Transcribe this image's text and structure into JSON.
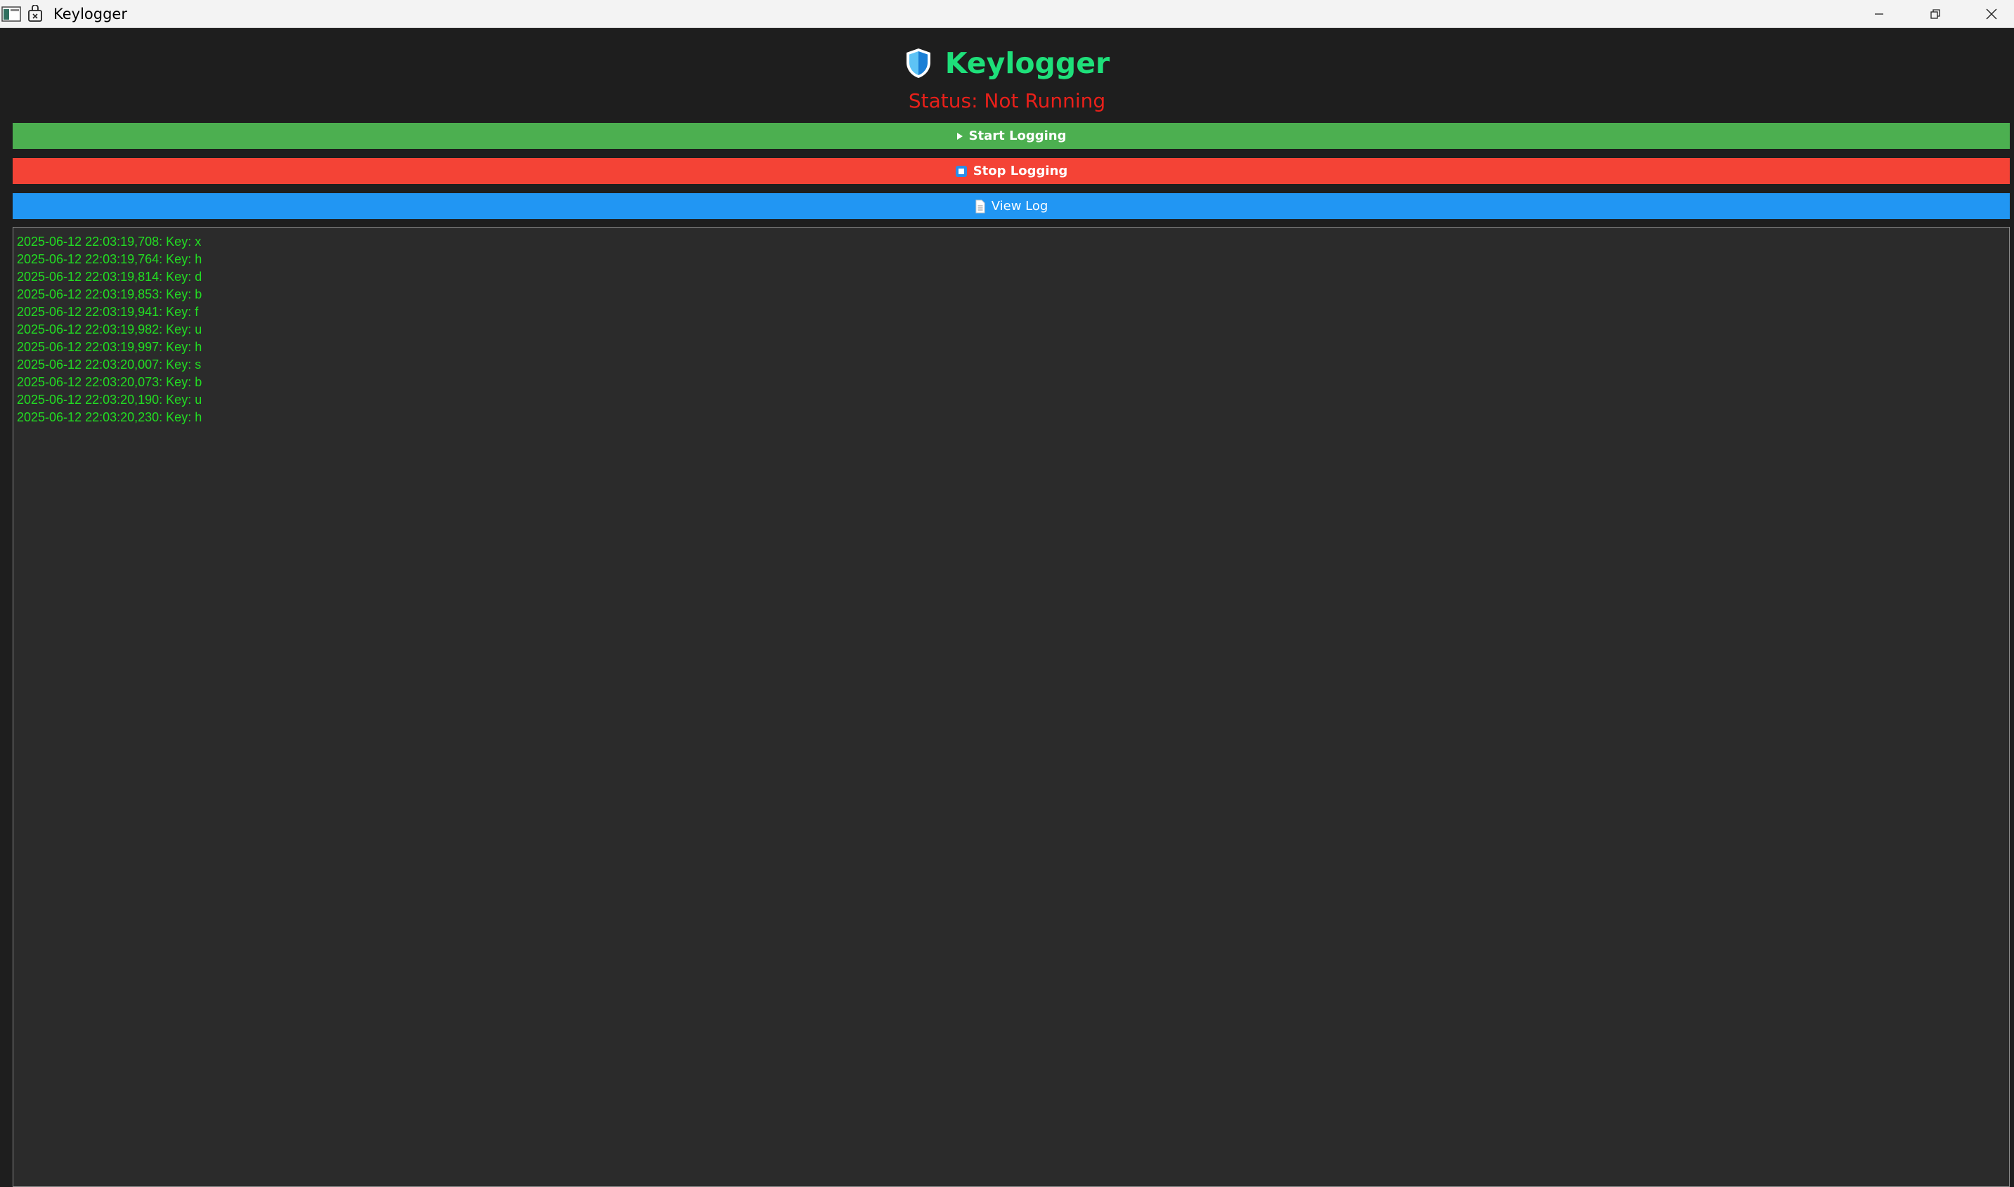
{
  "window": {
    "title": "Keylogger",
    "controls": [
      "minimize-icon",
      "restore-icon",
      "close-icon"
    ]
  },
  "header": {
    "title": "Keylogger",
    "logo_icon": "shield-icon",
    "status": "Status: Not Running"
  },
  "buttons": {
    "start": {
      "label": "Start Logging",
      "icon": "play-icon",
      "color": "#4caf50"
    },
    "stop": {
      "label": "Stop Logging",
      "icon": "stop-square-icon",
      "color": "#f44336"
    },
    "view": {
      "label": "View Log",
      "icon": "document-icon",
      "color": "#2196f3"
    }
  },
  "colors": {
    "background": "#1e1e1e",
    "log_background": "#2b2b2b",
    "title_text": "#1ee07a",
    "status_text": "#e8201a",
    "log_text": "#22dd22"
  },
  "log": {
    "lines": [
      "2025-06-12 22:03:19,708: Key: x",
      "2025-06-12 22:03:19,764: Key: h",
      "2025-06-12 22:03:19,814: Key: d",
      "2025-06-12 22:03:19,853: Key: b",
      "2025-06-12 22:03:19,941: Key: f",
      "2025-06-12 22:03:19,982: Key: u",
      "2025-06-12 22:03:19,997: Key: h",
      "2025-06-12 22:03:20,007: Key: s",
      "2025-06-12 22:03:20,073: Key: b",
      "2025-06-12 22:03:20,190: Key: u",
      "2025-06-12 22:03:20,230: Key: h"
    ]
  }
}
